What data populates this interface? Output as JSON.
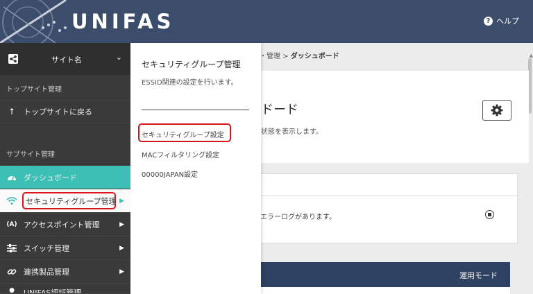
{
  "header": {
    "logo": "UNIFAS",
    "help_label": "ヘルプ",
    "help_icon": "question-circle-icon"
  },
  "sidebar": {
    "site_name": "サイト名",
    "top_section_label": "トップサイト管理",
    "back_to_top": "トップサイトに戻る",
    "sub_section_label": "サブサイト管理",
    "items": [
      {
        "label": "ダッシュボード",
        "icon": "dashboard-icon",
        "has_submenu": false
      },
      {
        "label": "セキュリティグループ管理",
        "icon": "wifi-icon",
        "has_submenu": true
      },
      {
        "label": "アクセスポイント管理",
        "icon": "access-point-icon",
        "has_submenu": true
      },
      {
        "label": "スイッチ管理",
        "icon": "sliders-icon",
        "has_submenu": true
      },
      {
        "label": "連携製品管理",
        "icon": "link-icon",
        "has_submenu": true
      },
      {
        "label": "UNIFAS認証管理",
        "icon": "auth-icon",
        "has_submenu": true
      }
    ]
  },
  "main": {
    "breadcrumb_prefix": "・管理 > ",
    "breadcrumb_current": "ダッシュボード",
    "page_title_partial": "ドード",
    "page_desc_partial": "状態を表示します。",
    "alert_msg_partial": "いエラーログがあります。",
    "mode_label": "運用モード"
  },
  "flyout": {
    "title": "セキュリティグループ管理",
    "description": "ESSID関連の設定を行います。",
    "links": [
      "セキュリティグループ設定",
      "MACフィルタリング設定",
      "00000JAPAN設定"
    ]
  },
  "colors": {
    "header_bg": "#3b4d6a",
    "sidebar_bg": "#3a3a3a",
    "active_teal": "#3cbfb4",
    "highlight_red": "#d9141c"
  }
}
